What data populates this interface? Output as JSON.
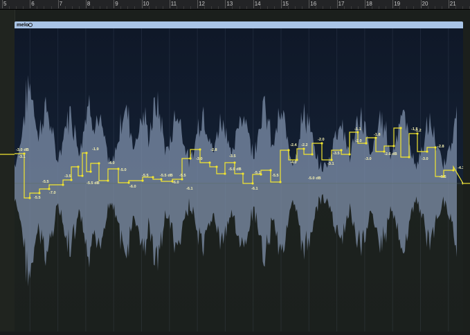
{
  "ruler": {
    "bars": [
      "5",
      "6",
      "7",
      "8",
      "9",
      "10",
      "11",
      "12",
      "13",
      "14",
      "15",
      "16",
      "17",
      "18",
      "19",
      "20",
      "21"
    ]
  },
  "region": {
    "name": "melo",
    "loop_icon": "loop-circle-icon"
  },
  "colors": {
    "region_header": "#a9c4e6",
    "region_bg_top": "#111a2b",
    "region_bg_bottom": "#1c211e",
    "waveform": "#7f90ab",
    "automation": "#f2e530"
  },
  "gain_labels": [
    "-3.0 dB",
    "-3.1",
    "-5.5",
    "-7.0",
    "-5.5",
    "-3.5",
    "-1.9",
    "-5.5 dB",
    "-4.0",
    "-5.0",
    "-6.0",
    "-5.5",
    "-5.5 dB",
    "-6.0",
    "-5.5",
    "-6.1",
    "-2.8",
    "-3.0",
    "-3.5",
    "-5.0 dB",
    "-5.1",
    "-6.1",
    "-5.5",
    "-2.4",
    "-2.2",
    "-2.0",
    "-4.0",
    "-3.1",
    "-5.0 dB",
    "-3.5",
    "-1.1",
    "-1.8",
    "-2.0",
    "-3.0",
    "-2.6 dB",
    "-1.5",
    "-1.2",
    "-3.0",
    "-2.8",
    "-5.5",
    "-4.3",
    "-6.1 dB"
  ]
}
